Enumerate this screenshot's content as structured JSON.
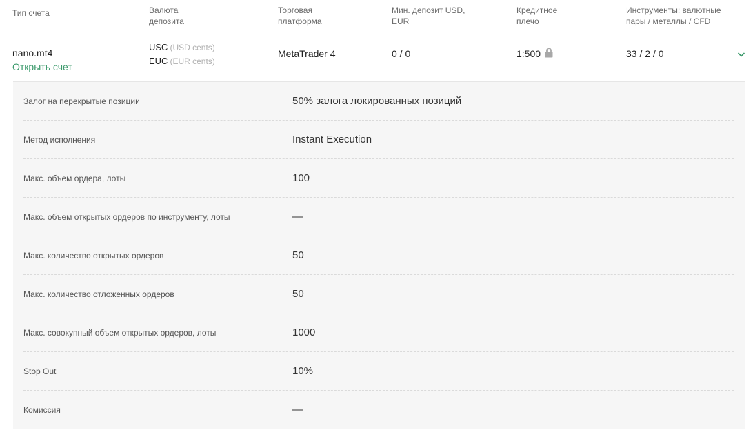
{
  "header": {
    "account_type": "Тип счета",
    "deposit_currency_1": "Валюта",
    "deposit_currency_2": "депозита",
    "platform_1": "Торговая",
    "platform_2": "платформа",
    "min_deposit_1": "Мин. депозит USD,",
    "min_deposit_2": "EUR",
    "leverage_1": "Кредитное",
    "leverage_2": "плечо",
    "instruments_1": "Инструменты: валютные",
    "instruments_2": "пары / металлы / CFD"
  },
  "account": {
    "name": "nano.mt4",
    "open_link": "Открыть счет",
    "currency_1_code": "USC",
    "currency_1_note": "(USD cents)",
    "currency_2_code": "EUC",
    "currency_2_note": "(EUR cents)",
    "platform": "MetaTrader 4",
    "min_deposit": "0 / 0",
    "leverage": "1:500",
    "instruments": "33 / 2 / 0"
  },
  "colors": {
    "accent": "#3c9a6c",
    "panel_bg": "#f6f6f6"
  },
  "details": [
    {
      "label": "Залог на перекрытые позиции",
      "value": "50% залога локированных позиций"
    },
    {
      "label": "Метод исполнения",
      "value": "Instant Execution"
    },
    {
      "label": "Макс. объем ордера, лоты",
      "value": "100"
    },
    {
      "label": "Макс. объем открытых ордеров по инструменту, лоты",
      "value": "—"
    },
    {
      "label": "Макс. количество открытых ордеров",
      "value": "50"
    },
    {
      "label": "Макс. количество отложенных ордеров",
      "value": "50"
    },
    {
      "label": "Макс. совокупный объем открытых ордеров, лоты",
      "value": "1000"
    },
    {
      "label": "Stop Out",
      "value": "10%"
    },
    {
      "label": "Комиссия",
      "value": "—"
    }
  ]
}
